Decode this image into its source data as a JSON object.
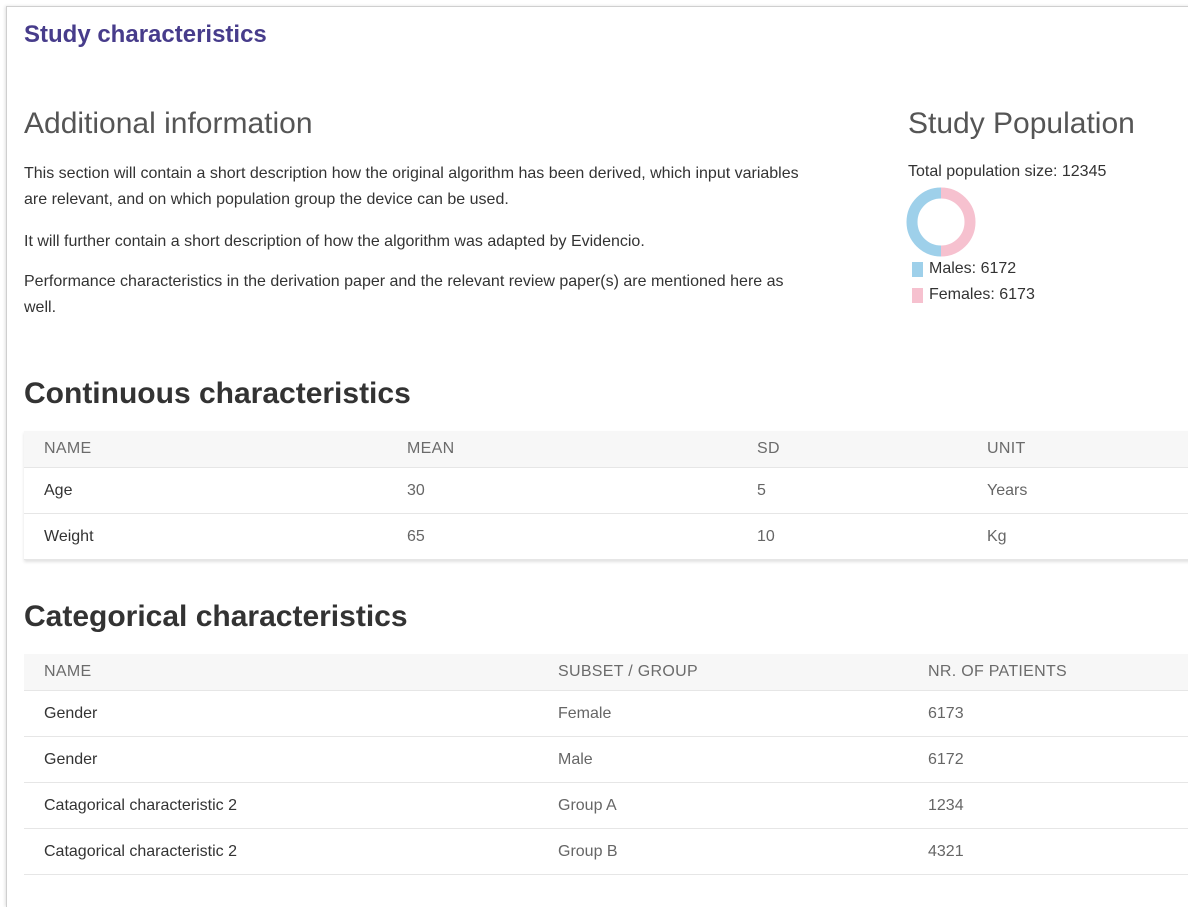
{
  "card": {
    "title": "Study characteristics"
  },
  "additional": {
    "heading": "Additional information",
    "paragraphs": [
      "This section will contain a short description how the original algorithm has been derived, which input variables are relevant, and on which population group the device can be used.",
      "It will further contain a short description of how the algorithm was adapted by Evidencio.",
      "Performance characteristics in the derivation paper and the relevant review paper(s) are mentioned here as well."
    ]
  },
  "population": {
    "heading": "Study Population",
    "total_label": "Total population size: 12345",
    "legend": [
      {
        "label": "Males: 6172",
        "color": "#9ed0ea"
      },
      {
        "label": "Females: 6173",
        "color": "#f6c1cf"
      }
    ]
  },
  "chart_data": {
    "type": "pie",
    "categories": [
      "Males",
      "Females"
    ],
    "values": [
      6172,
      6173
    ],
    "colors": [
      "#9ed0ea",
      "#f6c1cf"
    ],
    "title": "",
    "legend": "bottom-left"
  },
  "continuous": {
    "heading": "Continuous characteristics",
    "columns": [
      "NAME",
      "MEAN",
      "SD",
      "UNIT"
    ],
    "rows": [
      [
        "Age",
        "30",
        "5",
        "Years"
      ],
      [
        "Weight",
        "65",
        "10",
        "Kg"
      ]
    ]
  },
  "categorical": {
    "heading": "Categorical characteristics",
    "columns": [
      "NAME",
      "SUBSET / GROUP",
      "NR. OF PATIENTS"
    ],
    "rows": [
      [
        "Gender",
        "Female",
        "6173"
      ],
      [
        "Gender",
        "Male",
        "6172"
      ],
      [
        "Catagorical characteristic 2",
        "Group A",
        "1234"
      ],
      [
        "Catagorical characteristic 2",
        "Group B",
        "4321"
      ]
    ]
  }
}
